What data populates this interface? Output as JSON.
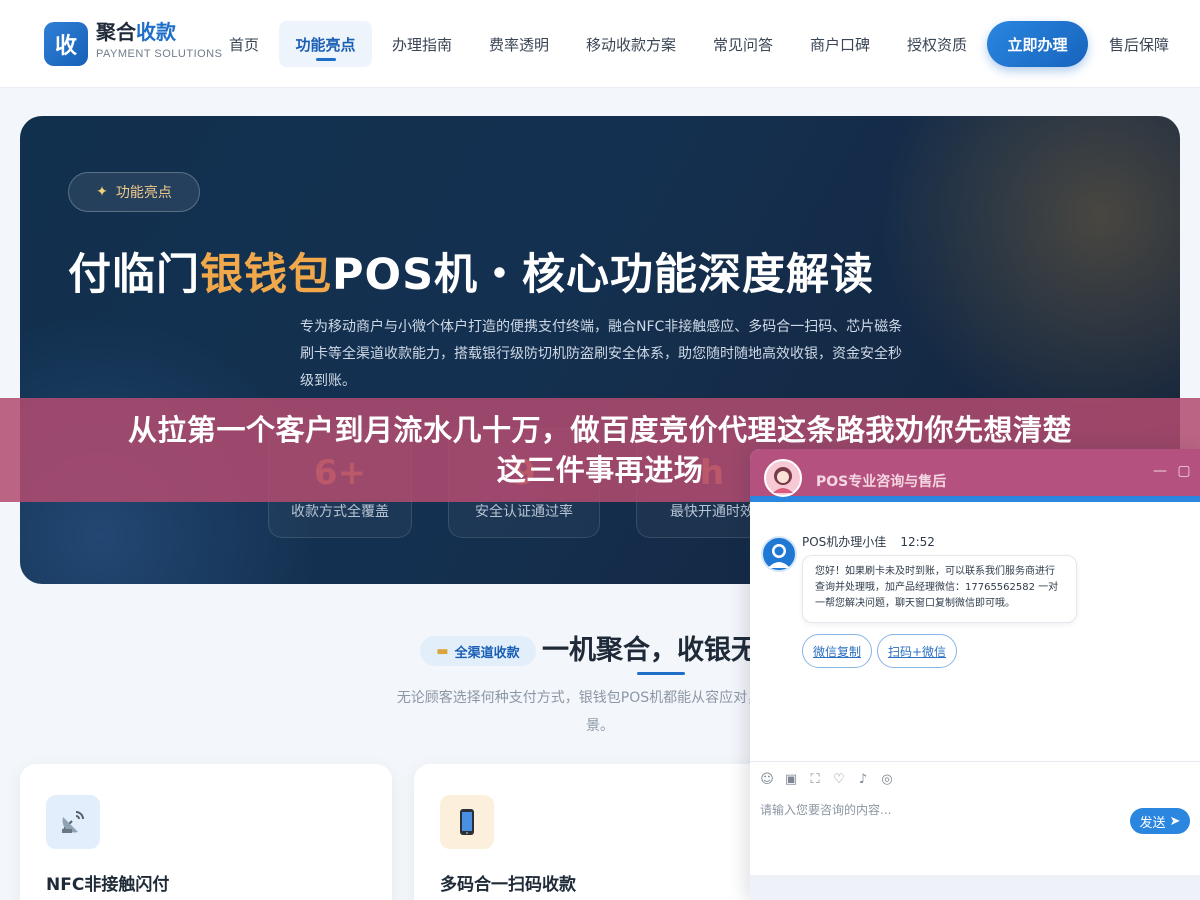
{
  "nav": {
    "logo_char": "收",
    "logo_title_main": "聚合",
    "logo_title_accent": "收款",
    "logo_subtitle": "PAYMENT SOLUTIONS",
    "items": [
      "首页",
      "功能亮点",
      "办理指南",
      "费率透明",
      "移动收款方案",
      "常见问答",
      "商户口碑",
      "授权资质"
    ],
    "active_item": "功能亮点",
    "cta": "立即办理",
    "after_sales": "售后保障"
  },
  "hero": {
    "badge": "功能亮点",
    "title_part1": "付临门",
    "title_highlight": "银钱包",
    "title_part2": "POS机・核心功能深度解读",
    "desc": "专为移动商户与小微个体户打造的便携支付终端，融合NFC非接触感应、多码合一扫码、芯片磁条刷卡等全渠道收款能力，搭载银行级防切机防盗刷安全体系，助您随时随地高效收银，资金安全秒级到账。",
    "stats": [
      {
        "num": "6+",
        "label": "收款方式全覆盖"
      },
      {
        "num": "9",
        "label": "安全认证通过率"
      },
      {
        "num": "h",
        "label": "最快开通时效"
      }
    ]
  },
  "banner": {
    "line1": "从拉第一个客户到月流水几十万，做百度竞价代理这条路我劝你先想清楚",
    "line2": "这三件事再进场"
  },
  "section": {
    "badge": "全渠道收款",
    "title": "一机聚合，收银无",
    "desc_line1": "无论顾客选择何种支付方式，银钱包POS机都能从容应对，覆盖当",
    "desc_line2": "景。",
    "cards": [
      {
        "name": "NFC非接触闪付",
        "icon": "satellite-dish-icon"
      },
      {
        "name": "多码合一扫码收款",
        "icon": "phone-icon"
      }
    ]
  },
  "chat": {
    "title": "POS专业咨询与售后",
    "agent_name": "POS机办理小佳",
    "time": "12:52",
    "message": "您好！如果刷卡未及时到账，可以联系我们服务商进行查询并处理哦，加产品经理微信：17765562582 一对一帮您解决问题，聊天窗口复制微信即可哦。",
    "link1": "微信复制",
    "link2": "扫码+微信",
    "input_placeholder": "请输入您要咨询的内容...",
    "send": "发送"
  },
  "colors": {
    "brand_blue": "#1f6fc9",
    "hero_gold": "#f0a84a",
    "banner_pink": "#b24c70",
    "chat_header": "#b5517e"
  }
}
